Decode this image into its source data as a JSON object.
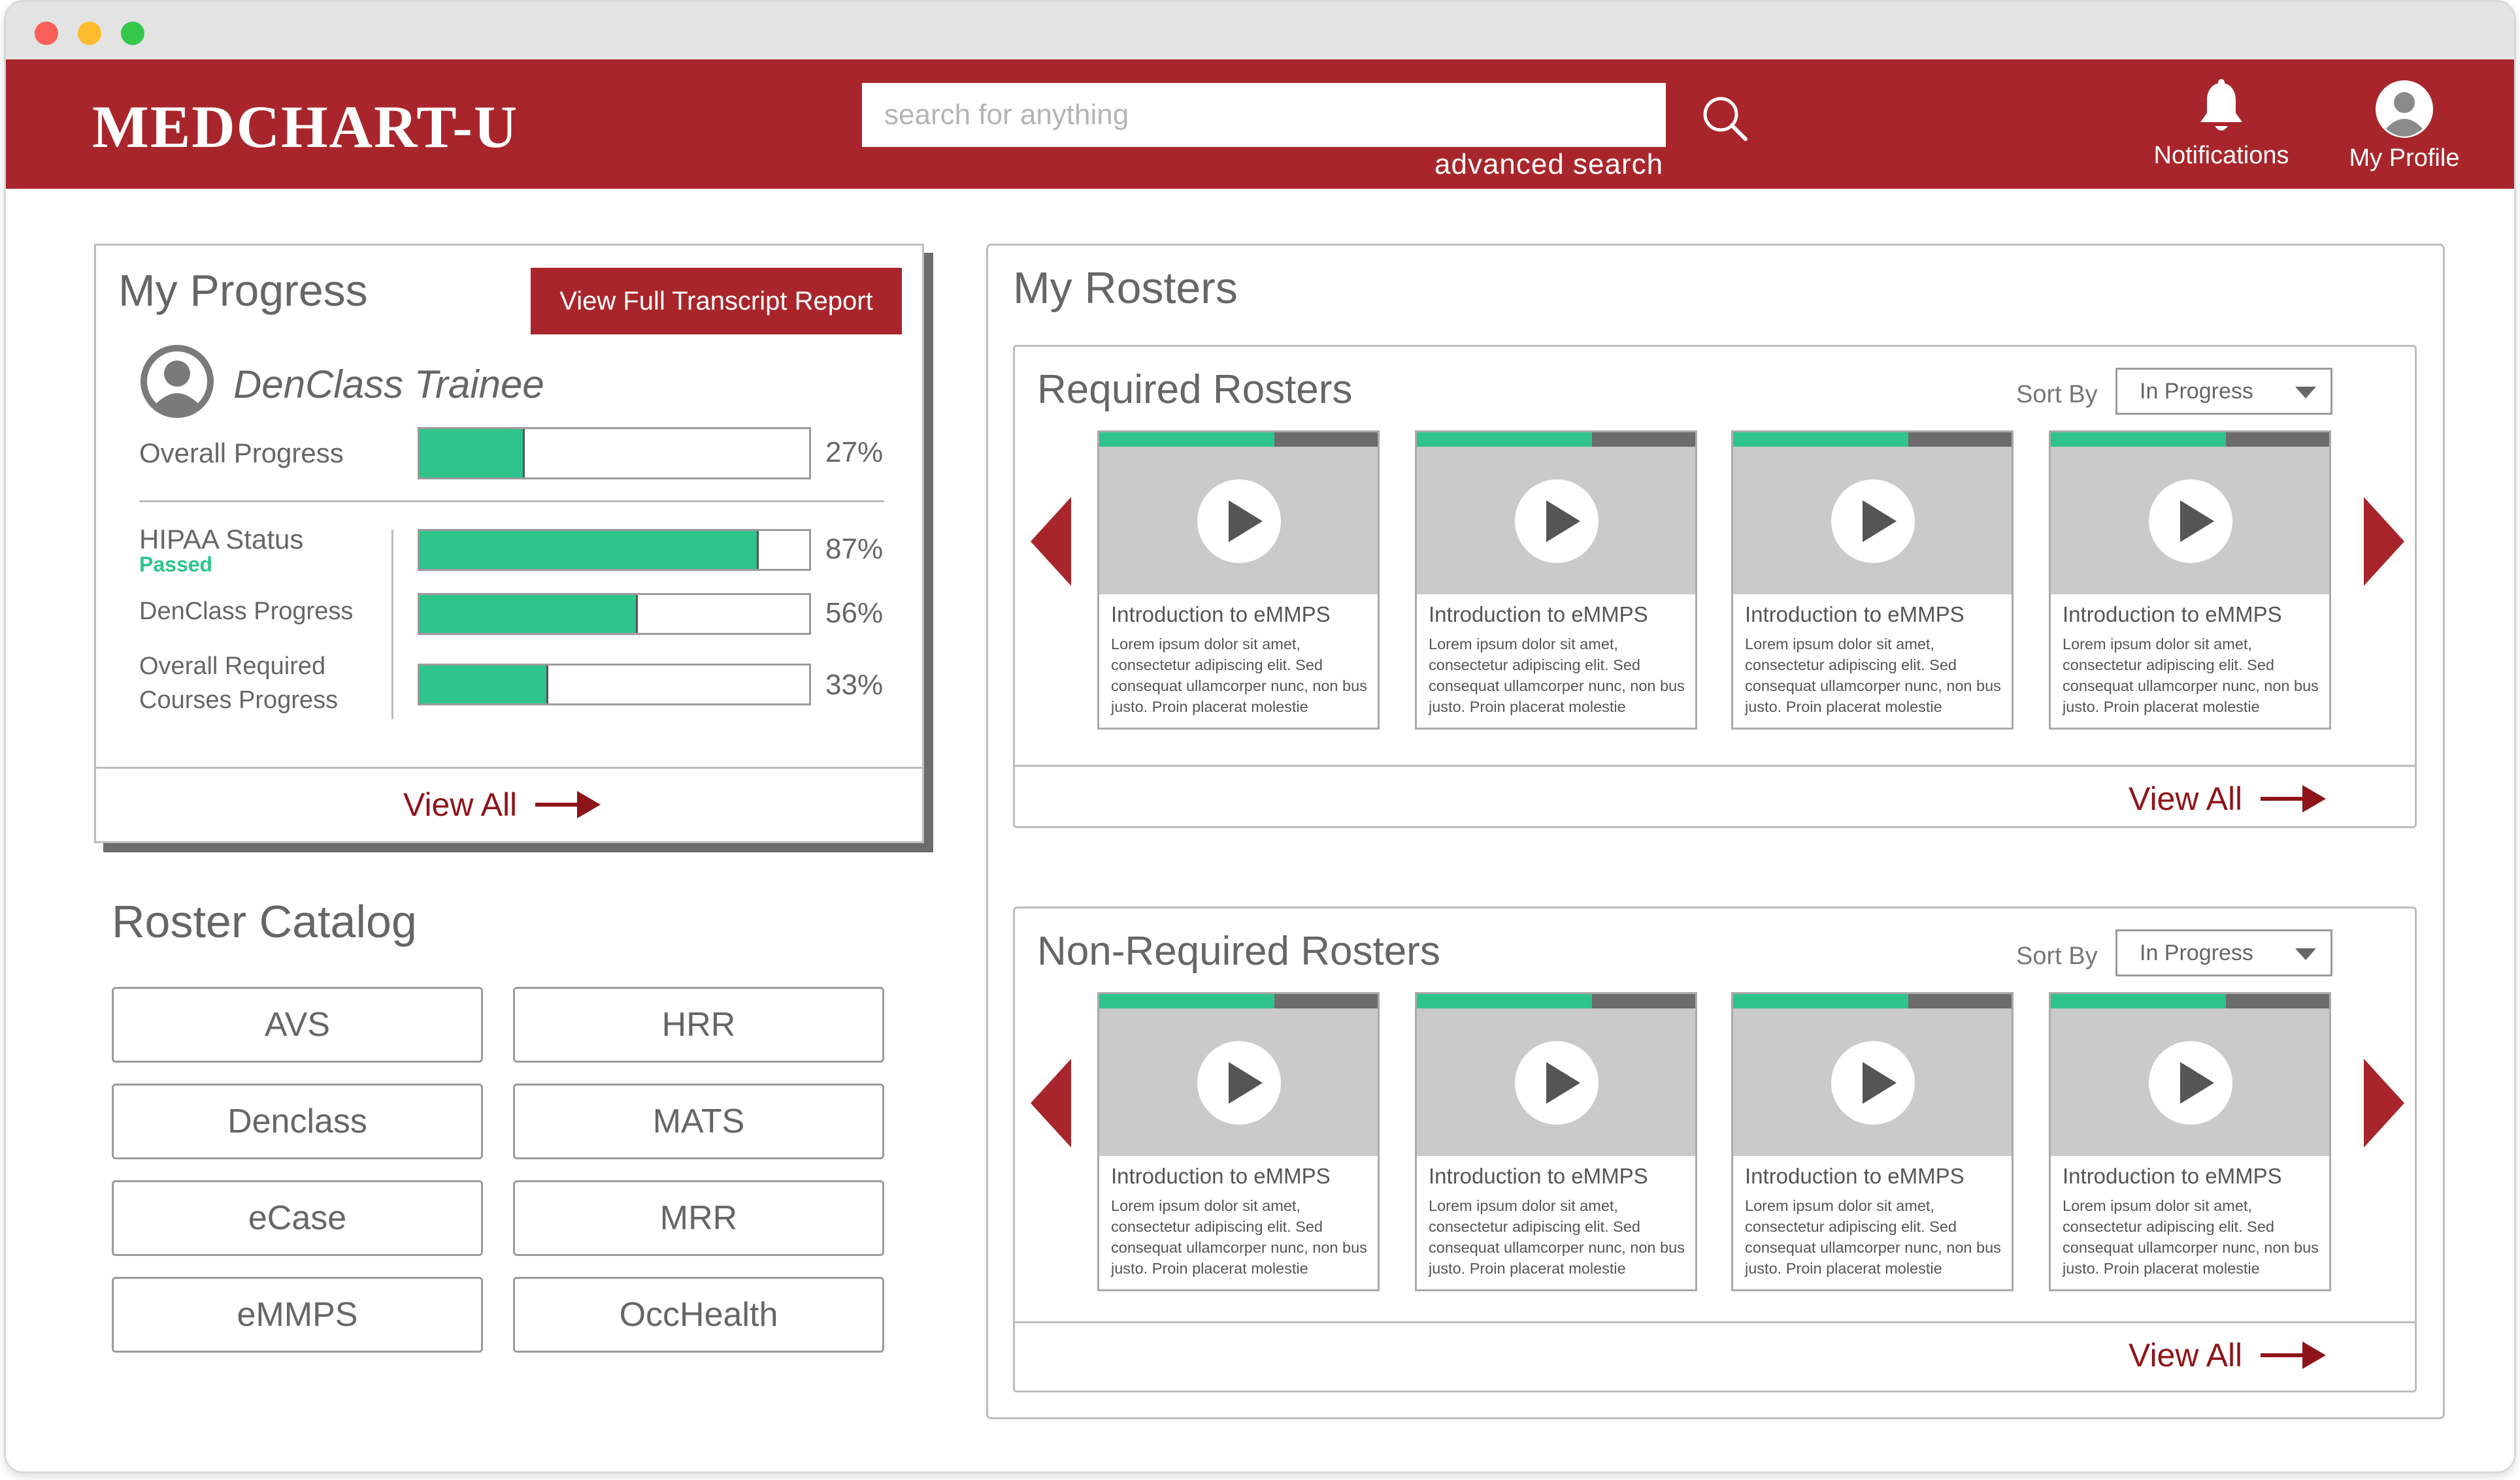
{
  "header": {
    "logo": "MEDCHART-U",
    "search_placeholder": "search for anything",
    "advanced_search": "advanced search",
    "notifications_label": "Notifications",
    "profile_label": "My Profile",
    "brand_color": "#a8262b"
  },
  "progress": {
    "title": "My Progress",
    "transcript_button": "View Full Transcript Report",
    "trainee_name": "DenClass Trainee",
    "overall": {
      "label": "Overall Progress",
      "percent_text": "27%",
      "value": 0.27
    },
    "hipaa": {
      "label": "HIPAA Status",
      "status": "Passed",
      "percent_text": "87%",
      "value": 0.87
    },
    "denclass": {
      "label": "DenClass Progress",
      "percent_text": "56%",
      "value": 0.56
    },
    "required": {
      "label_line1": "Overall Required",
      "label_line2": "Courses Progress",
      "percent_text": "33%",
      "value": 0.33
    },
    "view_all": "View All"
  },
  "catalog": {
    "title": "Roster Catalog",
    "items": [
      "AVS",
      "HRR",
      "Denclass",
      "MATS",
      "eCase",
      "MRR",
      "eMMPS",
      "OccHealth"
    ]
  },
  "rosters": {
    "title": "My Rosters",
    "required": {
      "title": "Required Rosters",
      "sort_label": "Sort By",
      "sort_value": "In Progress",
      "view_all": "View All",
      "cards": [
        {
          "title": "Introduction to eMMPS",
          "desc": "Lorem ipsum dolor sit amet, consectetur adipiscing elit. Sed consequat ullamcorper nunc, non bus justo. Proin placerat molestie",
          "progress": 0.63
        },
        {
          "title": "Introduction to eMMPS",
          "desc": "Lorem ipsum dolor sit amet, consectetur adipiscing elit. Sed consequat ullamcorper nunc, non bus justo. Proin placerat molestie",
          "progress": 0.63
        },
        {
          "title": "Introduction to eMMPS",
          "desc": "Lorem ipsum dolor sit amet, consectetur adipiscing elit. Sed consequat ullamcorper nunc, non bus justo. Proin placerat molestie",
          "progress": 0.63
        },
        {
          "title": "Introduction to eMMPS",
          "desc": "Lorem ipsum dolor sit amet, consectetur adipiscing elit. Sed consequat ullamcorper nunc, non bus justo. Proin placerat molestie",
          "progress": 0.63
        }
      ]
    },
    "non_required": {
      "title": "Non-Required Rosters",
      "sort_label": "Sort By",
      "sort_value": "In Progress",
      "view_all": "View All",
      "cards": [
        {
          "title": "Introduction to eMMPS",
          "desc": "Lorem ipsum dolor sit amet, consectetur adipiscing elit. Sed consequat ullamcorper nunc, non bus justo. Proin placerat molestie",
          "progress": 0.63
        },
        {
          "title": "Introduction to eMMPS",
          "desc": "Lorem ipsum dolor sit amet, consectetur adipiscing elit. Sed consequat ullamcorper nunc, non bus justo. Proin placerat molestie",
          "progress": 0.63
        },
        {
          "title": "Introduction to eMMPS",
          "desc": "Lorem ipsum dolor sit amet, consectetur adipiscing elit. Sed consequat ullamcorper nunc, non bus justo. Proin placerat molestie",
          "progress": 0.63
        },
        {
          "title": "Introduction to eMMPS",
          "desc": "Lorem ipsum dolor sit amet, consectetur adipiscing elit. Sed consequat ullamcorper nunc, non bus justo. Proin placerat molestie",
          "progress": 0.63
        }
      ]
    }
  }
}
